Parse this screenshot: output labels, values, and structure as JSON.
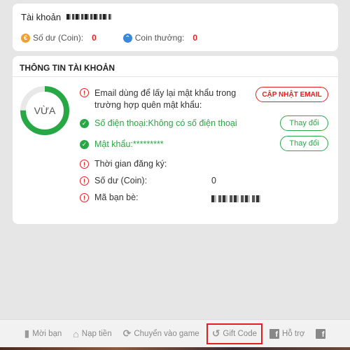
{
  "account": {
    "label": "Tài khoản",
    "balance_label": "Số dư (Coin):",
    "balance_value": "0",
    "bonus_label": "Coin thưởng:",
    "bonus_value": "0"
  },
  "info": {
    "header": "THÔNG TIN TÀI KHOẢN",
    "strength": "VỪA",
    "strength_level": 0.75,
    "email_text": "Email dùng để lấy lại mật khẩu trong trường hợp quên mật khẩu:",
    "update_email_button": "CẬP NHẬT EMAIL",
    "phone_text": "Số điện thoại:Không có số điện thoại",
    "phone_change_button": "Thay đổi",
    "password_text": "Mật khẩu:*********",
    "password_change_button": "Thay đổi",
    "registered_label": "Thời gian đăng ký:",
    "balance_label": "Số dư (Coin):",
    "balance_value": "0",
    "friend_code_label": "Mã bạn bè:"
  },
  "colors": {
    "red": "#e32020",
    "green": "#28a745",
    "blue": "#3a88d8",
    "orange": "#f0a030"
  },
  "nav": {
    "invite": "Mời bạn",
    "topup": "Nạp tiền",
    "switch_game": "Chuyển vào game",
    "gift_code": "Gift Code",
    "support": "Hỗ trợ"
  }
}
